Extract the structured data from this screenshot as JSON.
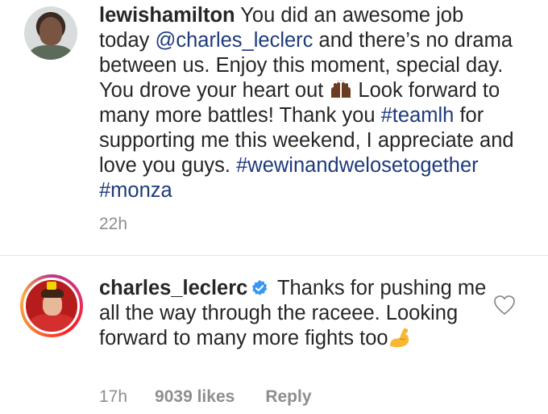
{
  "comments": [
    {
      "username": "lewishamilton",
      "text_1": " You did an awesome job today ",
      "mention": "@charles_leclerc",
      "text_2": " and there’s no drama between us. Enjoy this moment, special day. You drove your heart out ",
      "emoji_1": "raising-hands",
      "text_3": "Look forward to many more battles! Thank you ",
      "hashtag_1": "#teamlh",
      "text_4": " for supporting me this weekend, I appreciate and love you guys. ",
      "hashtag_2": "#wewinandwelosetogether",
      "text_5": " ",
      "hashtag_3": "#monza",
      "time": "22h"
    },
    {
      "username": "charles_leclerc",
      "verified": true,
      "text_1": " Thanks for pushing me all the way through the raceee. Looking forward to many more fights too",
      "emoji_1": "flexed-biceps",
      "time": "17h",
      "likes": "9039 likes",
      "reply_label": "Reply",
      "like_icon": "heart-outline-icon"
    }
  ],
  "colors": {
    "text": "#262626",
    "link": "#1e3a7b",
    "meta": "#8e8e8e",
    "verified": "#3897f0"
  }
}
